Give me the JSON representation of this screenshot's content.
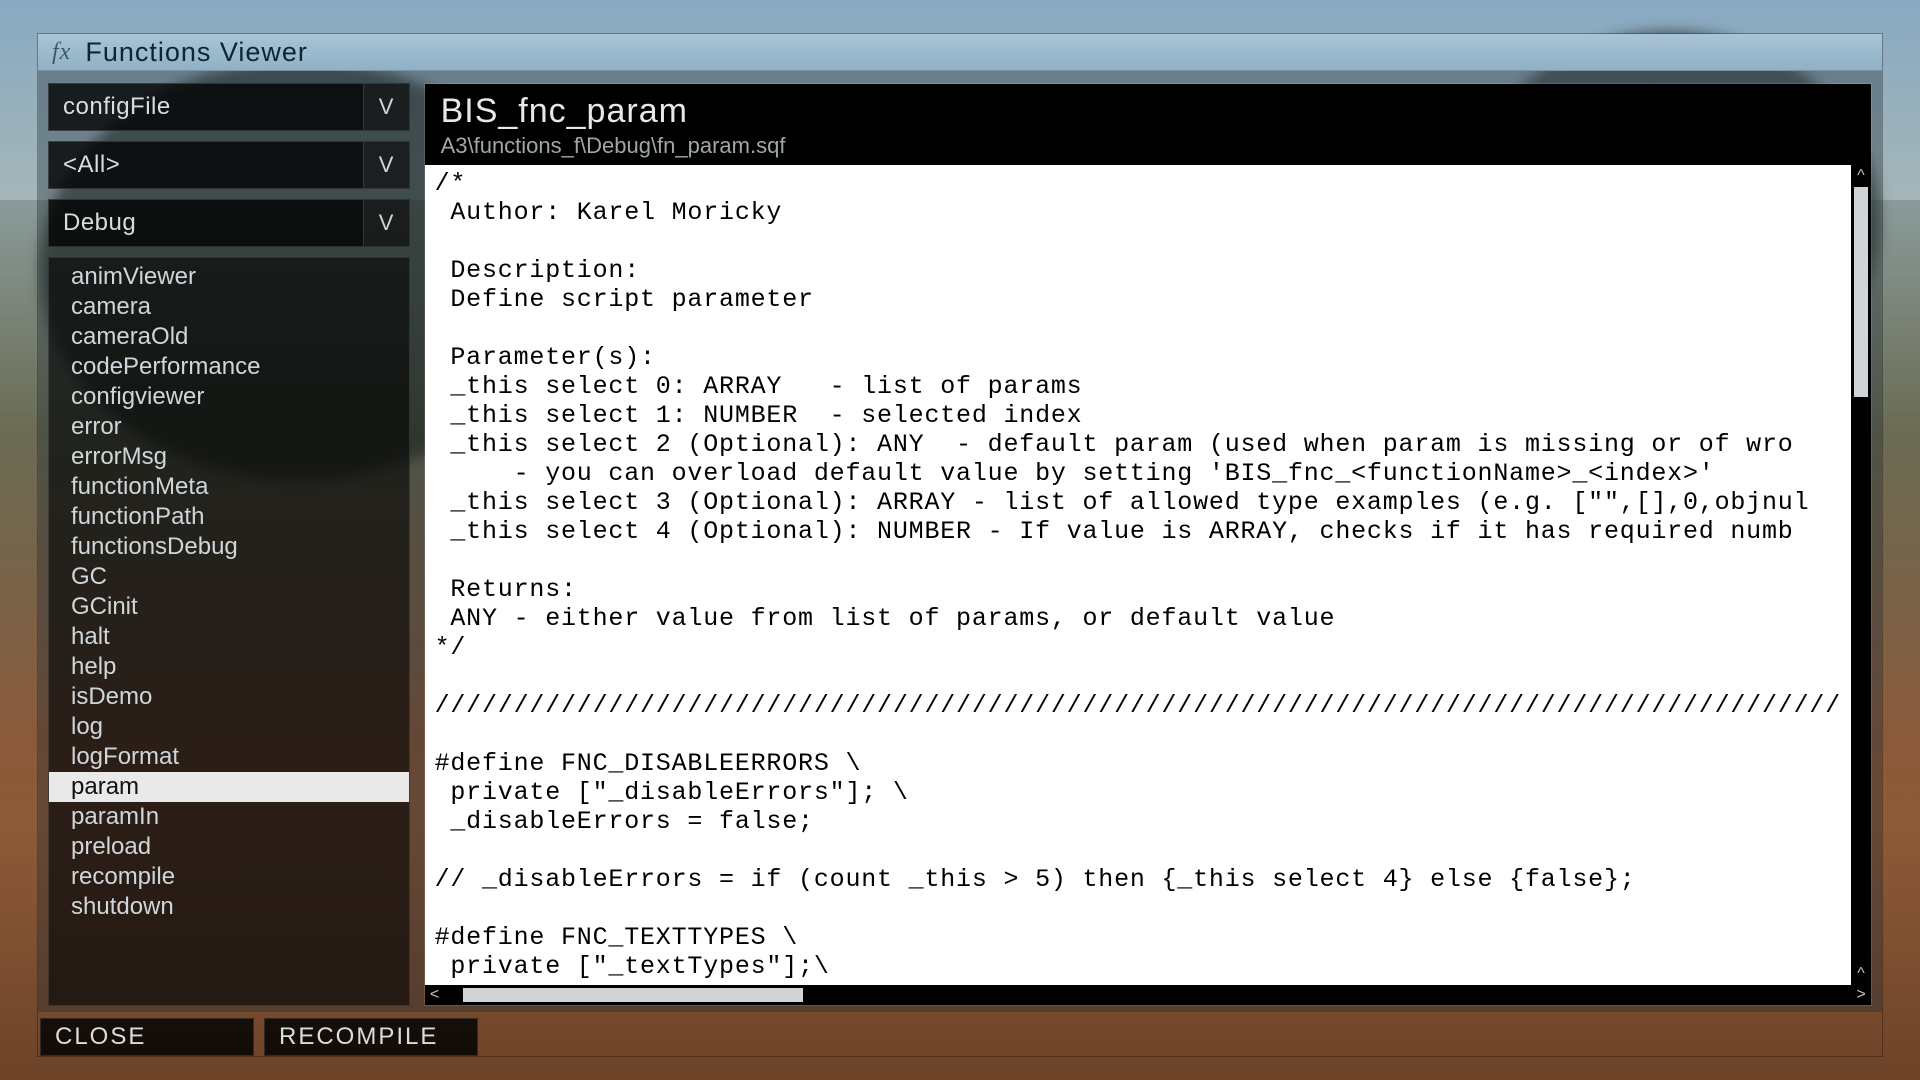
{
  "window": {
    "title": "Functions Viewer"
  },
  "dropdowns": {
    "source": {
      "value": "configFile"
    },
    "tag": {
      "value": "<All>"
    },
    "category": {
      "value": "Debug"
    }
  },
  "functions": [
    "animViewer",
    "camera",
    "cameraOld",
    "codePerformance",
    "configviewer",
    "error",
    "errorMsg",
    "functionMeta",
    "functionPath",
    "functionsDebug",
    "GC",
    "GCinit",
    "halt",
    "help",
    "isDemo",
    "log",
    "logFormat",
    "param",
    "paramIn",
    "preload",
    "recompile",
    "shutdown"
  ],
  "selected_function_index": 17,
  "detail": {
    "name": "BIS_fnc_param",
    "path": "A3\\functions_f\\Debug\\fn_param.sqf",
    "code": "/*\n Author: Karel Moricky\n\n Description:\n Define script parameter\n\n Parameter(s):\n _this select 0: ARRAY   - list of params\n _this select 1: NUMBER  - selected index\n _this select 2 (Optional): ANY  - default param (used when param is missing or of wro\n     - you can overload default value by setting 'BIS_fnc_<functionName>_<index>'\n _this select 3 (Optional): ARRAY - list of allowed type examples (e.g. [\"\",[],0,objnul\n _this select 4 (Optional): NUMBER - If value is ARRAY, checks if it has required numb\n\n Returns:\n ANY - either value from list of params, or default value\n*/\n\n/////////////////////////////////////////////////////////////////////////////////////////\n\n#define FNC_DISABLEERRORS \\\n private [\"_disableErrors\"]; \\\n _disableErrors = false;\n\n// _disableErrors = if (count _this > 5) then {_this select 4} else {false};\n\n#define FNC_TEXTTYPES \\\n private [\"_textTypes\"];\\"
  },
  "buttons": {
    "close": "CLOSE",
    "recompile": "RECOMPILE"
  }
}
